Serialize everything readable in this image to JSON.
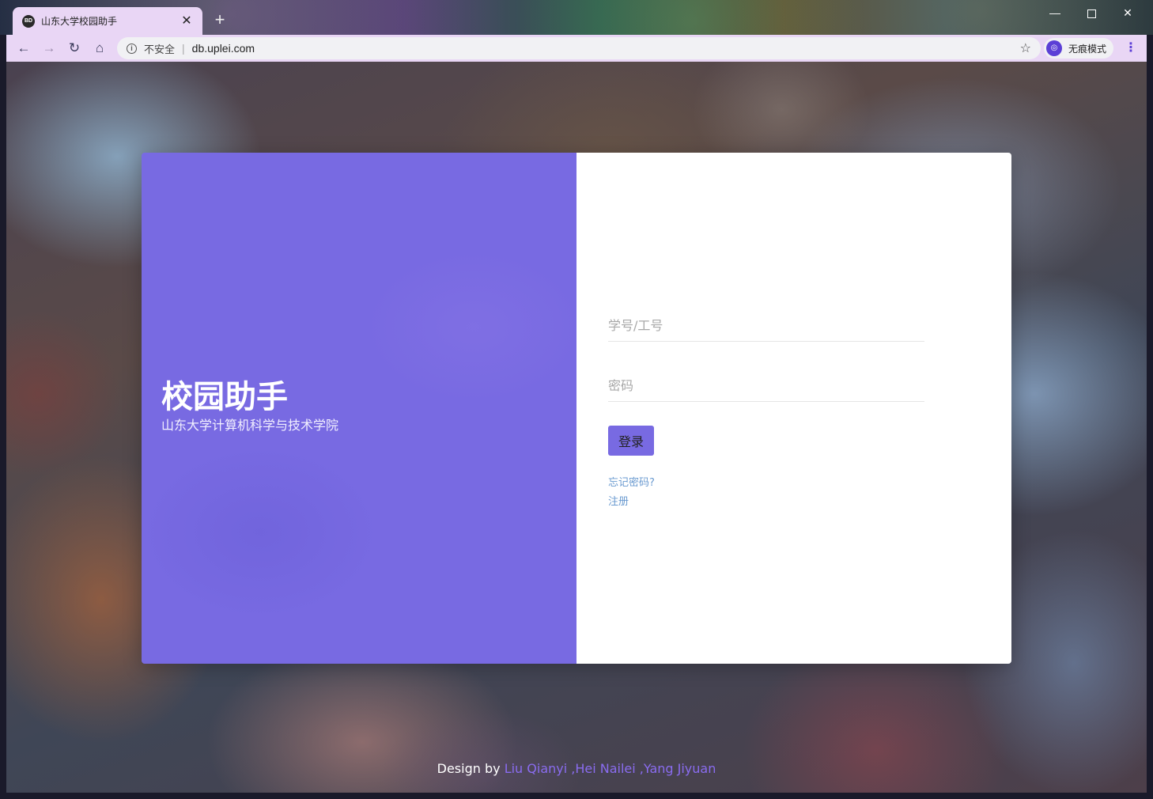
{
  "browser": {
    "tab_favicon_text": "BD",
    "tab_title": "山东大学校园助手",
    "tab_close": "✕",
    "new_tab": "+",
    "window_minimize": "—",
    "window_close": "✕",
    "nav_back": "←",
    "nav_forward": "→",
    "nav_reload": "↻",
    "nav_home": "⌂",
    "security_label": "不安全",
    "url": "db.uplei.com",
    "bookmark_icon": "☆",
    "profile_label": "无痕模式",
    "menu_icon": "⋮",
    "accent_color": "#5b3fd6"
  },
  "brand": {
    "title": "校园助手",
    "subtitle": "山东大学计算机科学与技术学院",
    "panel_color": "#786ae2"
  },
  "login_form": {
    "username_placeholder": "学号/工号",
    "password_placeholder": "密码",
    "submit_label": "登录",
    "forgot_link": "忘记密码?",
    "register_link": "注册"
  },
  "footer": {
    "prefix": "Design by ",
    "authors": "Liu Qianyi ,Hei Nailei ,Yang Jiyuan",
    "authors_color": "#8a6cf0"
  }
}
